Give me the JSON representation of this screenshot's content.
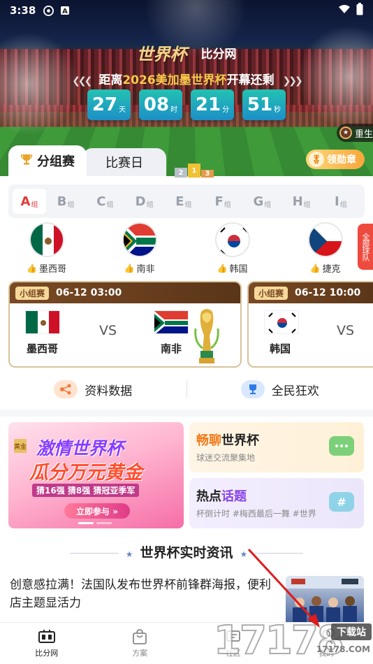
{
  "status_bar": {
    "time": "3:38"
  },
  "hero": {
    "brand_left": "世界杯",
    "brand_right": "比分网",
    "countdown_prefix": "距离",
    "countdown_highlight": "2026美加墨世界杯",
    "countdown_suffix": "开幕还剩",
    "countdown": [
      {
        "value": "27",
        "unit": "天"
      },
      {
        "value": "08",
        "unit": "时"
      },
      {
        "value": "21",
        "unit": "分"
      },
      {
        "value": "51",
        "unit": "秒"
      }
    ],
    "side_pill": "重生"
  },
  "tabs": {
    "group_stage": "分组赛",
    "match_day": "比赛日",
    "podium": [
      "2",
      "1",
      "3"
    ],
    "medal_button": "领勋章"
  },
  "groups": [
    {
      "letter": "A",
      "suffix": "组"
    },
    {
      "letter": "B",
      "suffix": "组"
    },
    {
      "letter": "C",
      "suffix": "组"
    },
    {
      "letter": "D",
      "suffix": "组"
    },
    {
      "letter": "E",
      "suffix": "组"
    },
    {
      "letter": "F",
      "suffix": "组"
    },
    {
      "letter": "G",
      "suffix": "组"
    },
    {
      "letter": "H",
      "suffix": "组"
    },
    {
      "letter": "I",
      "suffix": "组"
    }
  ],
  "teams": [
    "墨西哥",
    "南非",
    "韩国",
    "捷克"
  ],
  "all_teams_label": "全部球队",
  "matches": [
    {
      "tag": "小组赛",
      "time": "06-12 03:00",
      "home": "墨西哥",
      "away": "南非",
      "vs": "VS"
    },
    {
      "tag": "小组赛",
      "time": "06-12 10:00",
      "home": "韩国",
      "away": "",
      "vs": "VS"
    }
  ],
  "features": {
    "data_label": "资料数据",
    "fun_label": "全民狂欢"
  },
  "promo": {
    "badge": "黄金",
    "line1": "激情世界杯",
    "line2": "瓜分万元黄金",
    "line3": "猜16强 猜8强 猜冠亚季军",
    "button": "立即参与 »"
  },
  "chat_card": {
    "title_a": "畅聊",
    "title_b": "世界杯",
    "sub": "球迷交流聚集地"
  },
  "hot_card": {
    "title_a": "热点",
    "title_b": "话题",
    "sub": "杯倒计时 #梅西最后一舞 #世界"
  },
  "news": {
    "section_title": "世界杯实时资讯",
    "headline": "创意感拉满！法国队发布世界杯前锋群海报，便利店主题显活力"
  },
  "bottom_nav": [
    "比分网",
    "方案",
    "社区",
    "我的"
  ],
  "watermark": {
    "number": "17178",
    "download": "下载站",
    "domain": "17178.COM"
  },
  "colors": {
    "accent_red": "#e23b3b",
    "match_header": "#7a4a24",
    "countdown_teal": "#23c2b1"
  }
}
